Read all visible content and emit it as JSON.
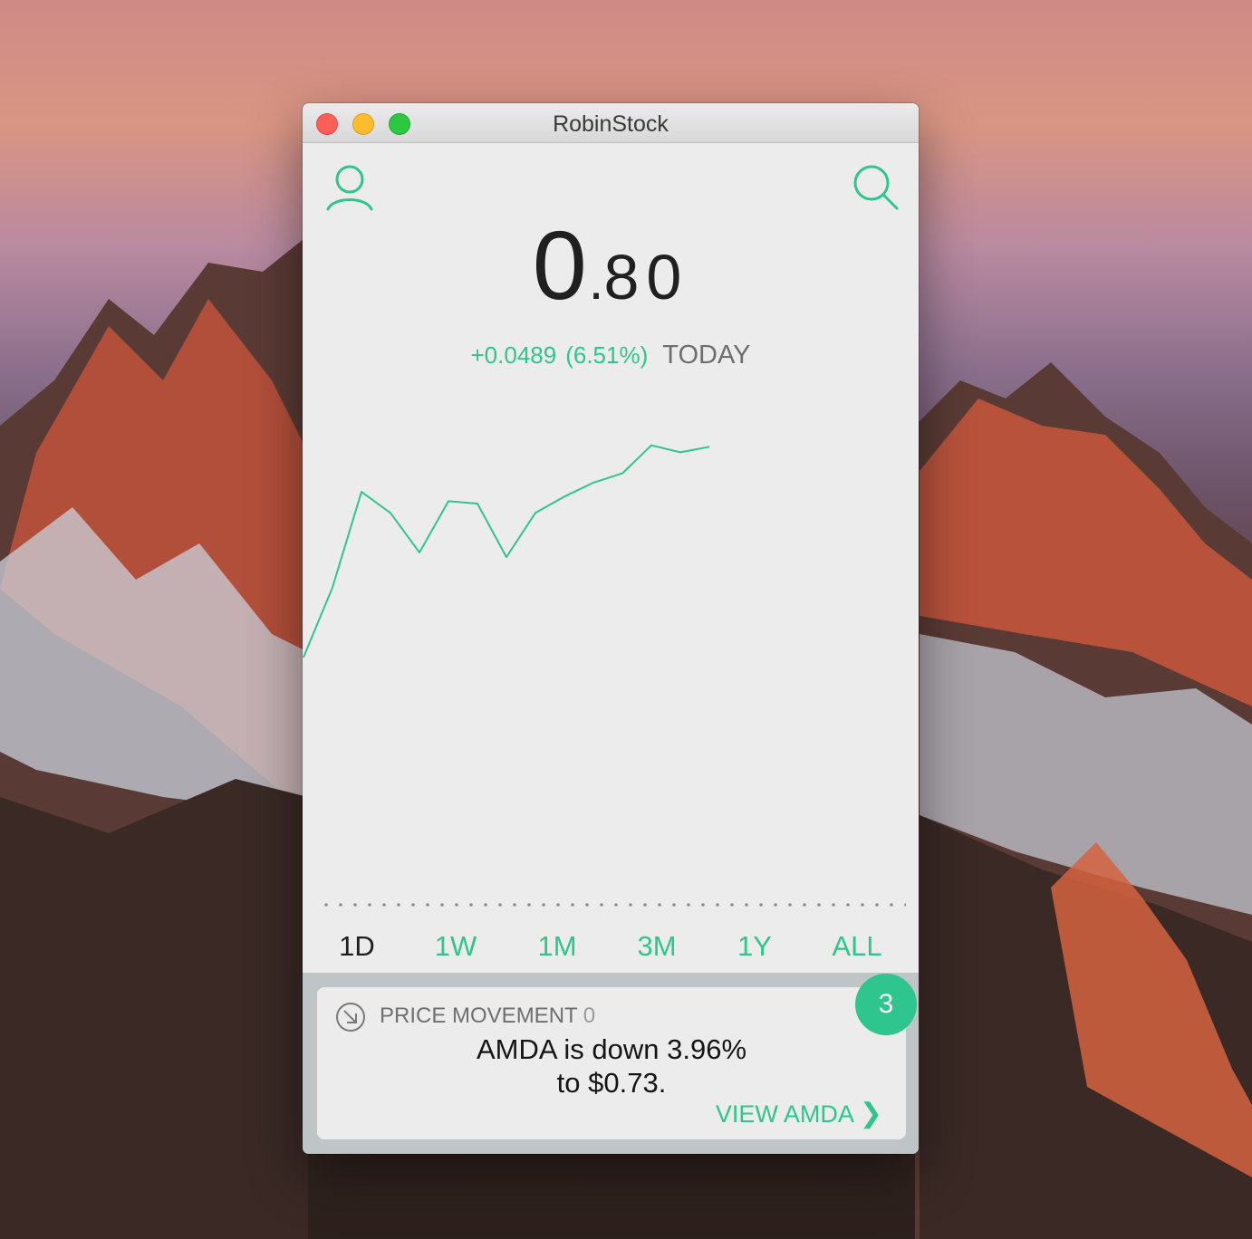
{
  "window": {
    "title": "RobinStock"
  },
  "header": {
    "account_icon": "user-icon",
    "search_icon": "search-icon"
  },
  "price": {
    "integer": "0",
    "separator": ".",
    "decimal": "80"
  },
  "change": {
    "delta": "+0.0489",
    "percent": "(6.51%)",
    "period": "TODAY"
  },
  "colors": {
    "accent": "#2fc58f",
    "text": "#202020",
    "tray": "#bfc4c6"
  },
  "chart_data": {
    "type": "line",
    "title": "",
    "xlabel": "",
    "ylabel": "",
    "grid": false,
    "x": [
      0,
      1,
      2,
      3,
      4,
      5,
      6,
      7,
      8,
      9,
      10,
      11,
      12,
      13,
      14
    ],
    "values": [
      0.726,
      0.741,
      0.7615,
      0.757,
      0.7485,
      0.7595,
      0.759,
      0.7475,
      0.757,
      0.7605,
      0.7635,
      0.7655,
      0.7715,
      0.77,
      0.7712
    ],
    "ylim": [
      0.71,
      0.78
    ],
    "xlim": [
      0,
      21
    ],
    "color": "#2fc58f"
  },
  "tabs": [
    {
      "label": "1D",
      "active": true
    },
    {
      "label": "1W",
      "active": false
    },
    {
      "label": "1M",
      "active": false
    },
    {
      "label": "3M",
      "active": false
    },
    {
      "label": "1Y",
      "active": false
    },
    {
      "label": "ALL",
      "active": false
    }
  ],
  "notification": {
    "icon": "arrow-down-right-icon",
    "category": "PRICE MOVEMENT",
    "count": "0",
    "line1": "AMDA is down 3.96%",
    "line2": "to $0.73.",
    "link": "VIEW AMDA",
    "link_icon": "chevron-right-icon",
    "badge": "3"
  }
}
